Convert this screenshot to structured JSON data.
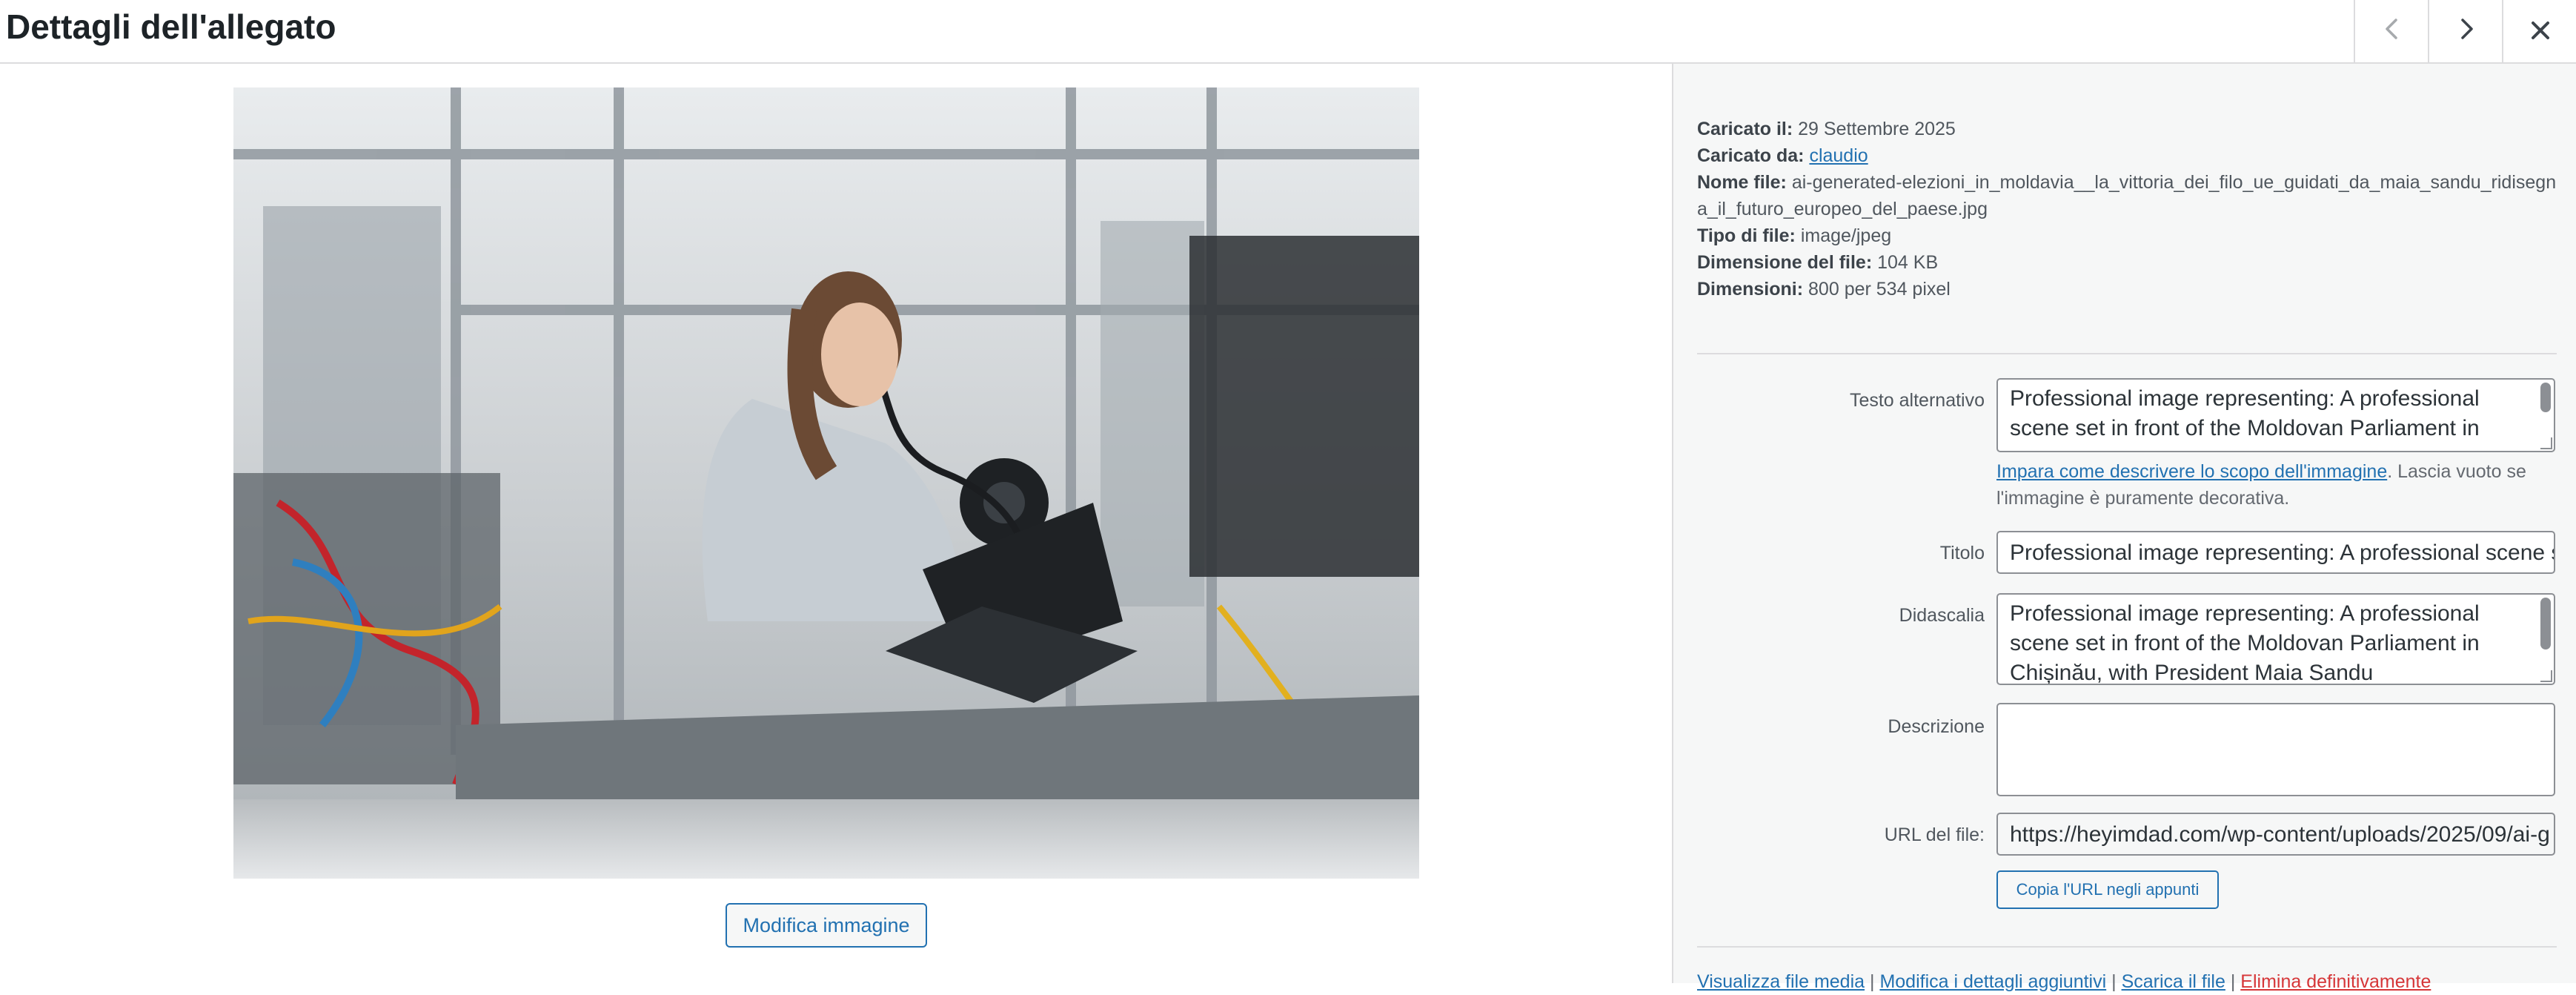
{
  "header": {
    "title": "Dettagli dell'allegato",
    "prev_icon": "chevron-left-icon",
    "next_icon": "chevron-right-icon",
    "close_icon": "close-icon"
  },
  "main": {
    "image_description": "",
    "edit_button": "Modifica immagine"
  },
  "details": {
    "uploaded_on_label": "Caricato il:",
    "uploaded_on": "29 Settembre 2025",
    "uploaded_by_label": "Caricato da:",
    "uploaded_by": "claudio",
    "file_name_label": "Nome file:",
    "file_name": "ai-generated-elezioni_in_moldavia__la_vittoria_dei_filo_ue_guidati_da_maia_sandu_ridisegna_il_futuro_europeo_del_paese.jpg",
    "file_type_label": "Tipo di file:",
    "file_type": "image/jpeg",
    "file_size_label": "Dimensione del file:",
    "file_size": "104 KB",
    "dimensions_label": "Dimensioni:",
    "dimensions": "800 per 534 pixel"
  },
  "form": {
    "alt_label": "Testo alternativo",
    "alt_value": "Professional image representing: A professional scene set in front of the Moldovan Parliament in",
    "alt_help_link": "Impara come descrivere lo scopo dell'immagine",
    "alt_help_text": ". Lascia vuoto se l'immagine è puramente decorativa.",
    "title_label": "Titolo",
    "title_value": "Professional image representing: A professional scene s",
    "caption_label": "Didascalia",
    "caption_value": "Professional image representing: A professional scene set in front of the Moldovan Parliament in Chișinău, with President Maia Sandu",
    "description_label": "Descrizione",
    "description_value": "",
    "url_label": "URL del file:",
    "url_value": "https://heyimdad.com/wp-content/uploads/2025/09/ai-g",
    "copy_button": "Copia l'URL negli appunti"
  },
  "actions": {
    "view": "Visualizza file media",
    "edit_more": "Modifica i dettagli aggiuntivi",
    "download": "Scarica il file",
    "delete": "Elimina definitivamente",
    "sep": " | "
  }
}
